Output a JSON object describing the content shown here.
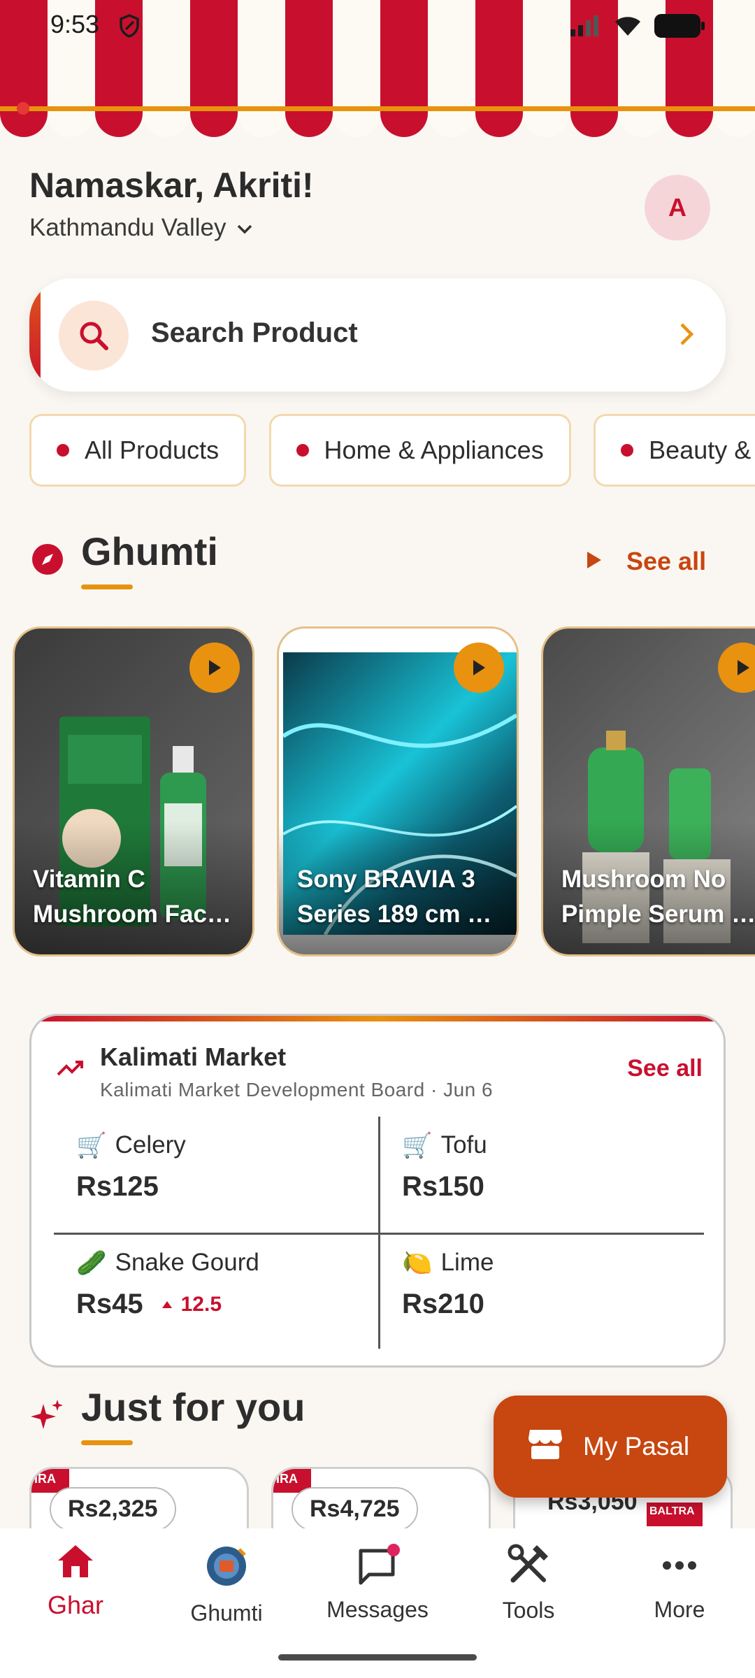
{
  "status": {
    "time": "9:53"
  },
  "header": {
    "greeting": "Namaskar, Akriti!",
    "location": "Kathmandu Valley",
    "avatar_initial": "A"
  },
  "search": {
    "placeholder": "Search Product"
  },
  "categories": [
    "All Products",
    "Home & Appliances",
    "Beauty &"
  ],
  "ghumti": {
    "title": "Ghumti",
    "see_all": "See all",
    "videos": [
      {
        "title": "Vitamin C Mushroom Fac…"
      },
      {
        "title": "Sony BRAVIA 3 Series 189 cm …"
      },
      {
        "title": "Mushroom No Pimple Serum …"
      }
    ]
  },
  "market": {
    "title": "Kalimati Market",
    "subtitle": "Kalimati Market Development Board · Jun 6",
    "see_all": "See all",
    "items": [
      {
        "emoji": "🛒",
        "name": "Celery",
        "price": "Rs125",
        "delta": ""
      },
      {
        "emoji": "🛒",
        "name": "Tofu",
        "price": "Rs150",
        "delta": ""
      },
      {
        "emoji": "🥒",
        "name": "Snake Gourd",
        "price": "Rs45",
        "delta": "12.5"
      },
      {
        "emoji": "🍋",
        "name": "Lime",
        "price": "Rs210",
        "delta": ""
      }
    ]
  },
  "just_for_you": {
    "title": "Just for you",
    "products": [
      {
        "price": "Rs2,325",
        "brand": "IRA"
      },
      {
        "price": "Rs4,725",
        "brand": "IRA"
      },
      {
        "price": "Rs3,050",
        "brand": "BALTRA"
      }
    ]
  },
  "fab": {
    "label": "My Pasal"
  },
  "nav": [
    {
      "label": "Ghar",
      "icon": "home-icon",
      "active": true
    },
    {
      "label": "Ghumti",
      "icon": "ghumti-icon",
      "active": false
    },
    {
      "label": "Messages",
      "icon": "chat-icon",
      "active": false
    },
    {
      "label": "Tools",
      "icon": "tools-icon",
      "active": false
    },
    {
      "label": "More",
      "icon": "more-icon",
      "active": false
    }
  ],
  "colors": {
    "brand_red": "#c8102e",
    "accent_orange": "#e8920f",
    "fab_orange": "#c8460f",
    "background": "#faf7f2"
  }
}
